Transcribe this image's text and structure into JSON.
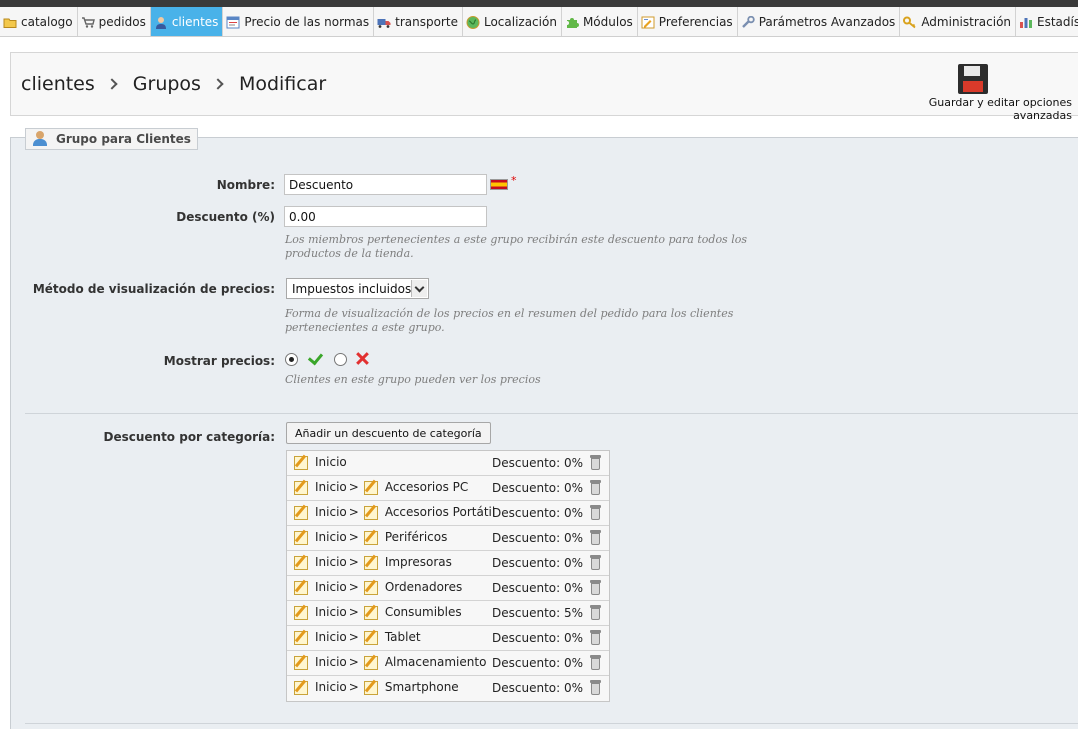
{
  "nav": {
    "tabs": [
      {
        "label": "catalogo",
        "icon": "folder-icon"
      },
      {
        "label": "pedidos",
        "icon": "cart-icon"
      },
      {
        "label": "clientes",
        "icon": "customer-icon",
        "active": true
      },
      {
        "label": "Precio de las normas",
        "icon": "price-rules-icon"
      },
      {
        "label": "transporte",
        "icon": "truck-icon"
      },
      {
        "label": "Localización",
        "icon": "globe-icon"
      },
      {
        "label": "Módulos",
        "icon": "puzzle-icon"
      },
      {
        "label": "Preferencias",
        "icon": "preferences-icon"
      },
      {
        "label": "Parámetros Avanzados",
        "icon": "wrench-icon"
      },
      {
        "label": "Administración",
        "icon": "key-icon"
      },
      {
        "label": "Estadístic",
        "icon": "stats-icon"
      }
    ]
  },
  "breadcrumb": [
    "clientes",
    "Grupos",
    "Modificar"
  ],
  "toolbar": {
    "save_label": "Guardar y editar opciones avanzadas",
    "save_icon": "floppy-disk-icon"
  },
  "form": {
    "legend": "Grupo para Clientes",
    "name_label": "Nombre:",
    "name_value": "Descuento",
    "required_mark": "*",
    "discount_label": "Descuento (%)",
    "discount_value": "0.00",
    "discount_hint": "Los miembros pertenecientes a este grupo recibirán este descuento para todos los productos de la tienda.",
    "price_display_label": "Método de visualización de precios:",
    "price_display_value": "Impuestos incluidos",
    "price_display_hint": "Forma de visualización de los precios en el resumen del pedido para los clientes pertenecientes a este grupo.",
    "show_prices_label": "Mostrar precios:",
    "show_prices_selected": "yes",
    "show_prices_hint": "Clientes en este grupo pueden ver los precios",
    "category_discount_label": "Descuento por categoría:",
    "add_category_button": "Añadir un descuento de categoría"
  },
  "categories": [
    {
      "root": "Inicio",
      "sep": "",
      "name": "",
      "discount": "Descuento: 0%"
    },
    {
      "root": "Inicio",
      "sep": ">",
      "name": "Accesorios PC",
      "discount": "Descuento: 0%"
    },
    {
      "root": "Inicio",
      "sep": ">",
      "name": "Accesorios Portátil",
      "discount": "Descuento: 0%"
    },
    {
      "root": "Inicio",
      "sep": ">",
      "name": "Periféricos",
      "discount": "Descuento: 0%"
    },
    {
      "root": "Inicio",
      "sep": ">",
      "name": "Impresoras",
      "discount": "Descuento: 0%"
    },
    {
      "root": "Inicio",
      "sep": ">",
      "name": "Ordenadores",
      "discount": "Descuento: 0%"
    },
    {
      "root": "Inicio",
      "sep": ">",
      "name": "Consumibles",
      "discount": "Descuento: 5%"
    },
    {
      "root": "Inicio",
      "sep": ">",
      "name": "Tablet",
      "discount": "Descuento: 0%"
    },
    {
      "root": "Inicio",
      "sep": ">",
      "name": "Almacenamiento",
      "discount": "Descuento: 0%"
    },
    {
      "root": "Inicio",
      "sep": ">",
      "name": "Smartphone",
      "discount": "Descuento: 0%"
    }
  ],
  "colors": {
    "active_tab": "#49b2e9",
    "panel_bg": "#eaeef2",
    "required": "#dd0000",
    "yes": "#3aa62a",
    "no": "#e23030"
  }
}
